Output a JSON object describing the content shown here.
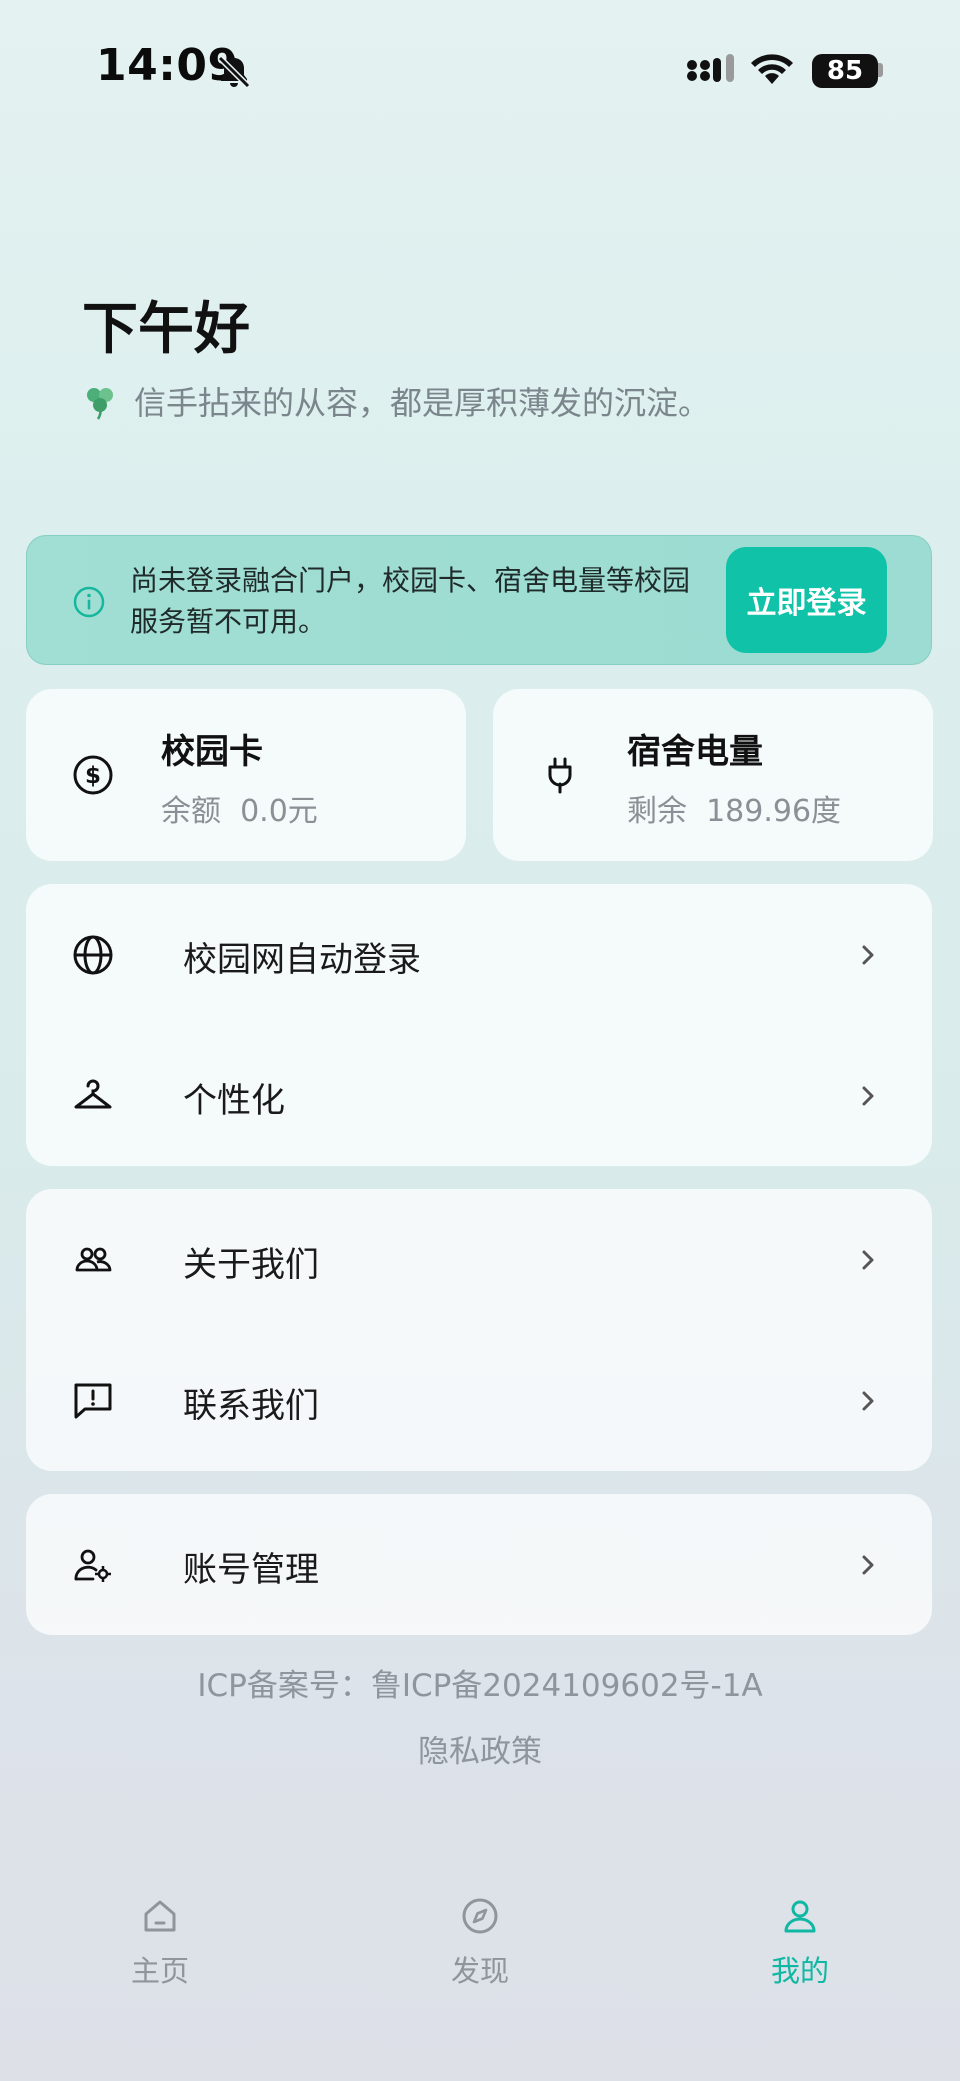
{
  "status_bar": {
    "time": "14:09",
    "battery": "85",
    "icons": [
      "bell-slash-icon",
      "cellular-signal-icon",
      "wifi-icon",
      "battery-icon"
    ]
  },
  "greeting": {
    "title": "下午好",
    "subtitle": "信手拈来的从容，都是厚积薄发的沉淀。",
    "subtitle_icon": "clover-icon"
  },
  "login_banner": {
    "icon": "info-icon",
    "text": "尚未登录融合门户，校园卡、宿舍电量等校园服务暂不可用。",
    "button_label": "立即登录",
    "accent_color": "#10c2a8"
  },
  "cards": [
    {
      "icon": "dollar-circle-icon",
      "title": "校园卡",
      "label": "余额",
      "value": "0.0元"
    },
    {
      "icon": "plug-icon",
      "title": "宿舍电量",
      "label": "剩余",
      "value": "189.96度"
    }
  ],
  "menu_groups": [
    [
      {
        "icon": "globe-icon",
        "label": "校园网自动登录"
      },
      {
        "icon": "hanger-icon",
        "label": "个性化"
      }
    ],
    [
      {
        "icon": "users-icon",
        "label": "关于我们"
      },
      {
        "icon": "message-alert-icon",
        "label": "联系我们"
      }
    ],
    [
      {
        "icon": "user-settings-icon",
        "label": "账号管理"
      }
    ]
  ],
  "footer": {
    "icp": "ICP备案号：鲁ICP备2024109602号-1A",
    "privacy": "隐私政策"
  },
  "tabbar": {
    "items": [
      {
        "icon": "home-icon",
        "label": "主页",
        "active": false
      },
      {
        "icon": "compass-icon",
        "label": "发现",
        "active": false
      },
      {
        "icon": "user-icon",
        "label": "我的",
        "active": true
      }
    ],
    "active_color": "#10b8a3",
    "inactive_color": "#8e959b"
  }
}
